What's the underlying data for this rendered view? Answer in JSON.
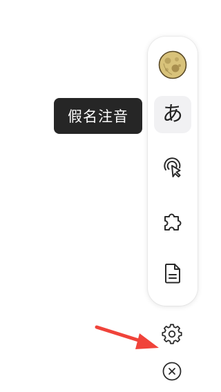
{
  "toolbar": {
    "items": [
      {
        "name": "avatar",
        "icon": "moon-avatar-icon"
      },
      {
        "name": "kana",
        "glyph": "あ",
        "icon": "hiragana-icon",
        "active": true
      },
      {
        "name": "cursor",
        "icon": "touch-cursor-icon"
      },
      {
        "name": "extension",
        "icon": "puzzle-icon"
      },
      {
        "name": "document",
        "icon": "document-icon"
      }
    ]
  },
  "tooltip": {
    "text": "假名注音"
  },
  "floating": {
    "settings_icon": "gear-icon",
    "close_icon": "close-circle-icon"
  },
  "annotation": {
    "arrow_color": "#f0433a"
  },
  "colors": {
    "tooltip_bg": "#262626",
    "active_bg": "#f1f1f3",
    "icon": "#2a2a2a"
  }
}
